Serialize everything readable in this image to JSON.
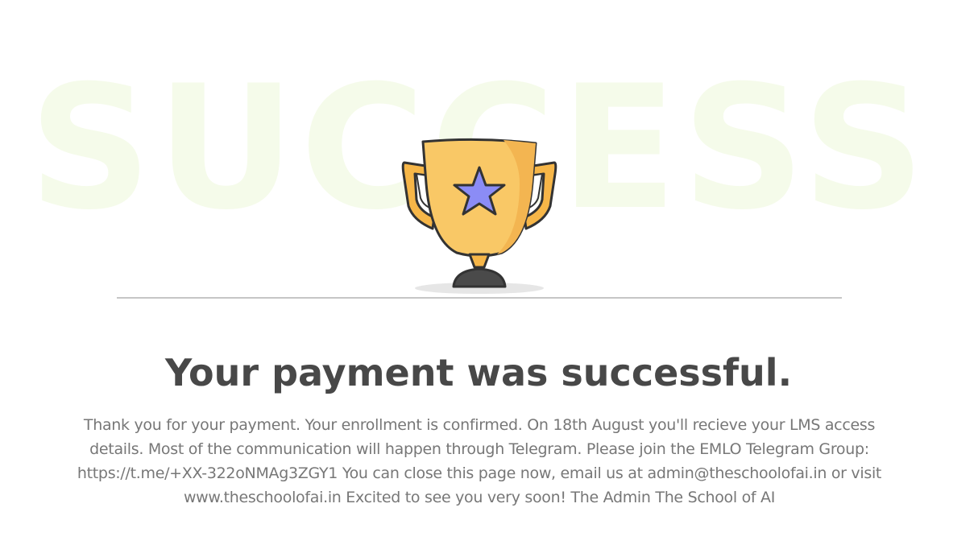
{
  "hero": {
    "background_word": "SUCCESS",
    "trophy_icon": "trophy-star-icon"
  },
  "content": {
    "title": "Your payment was successful.",
    "message": "Thank you for your payment. Your enrollment is confirmed. On 18th August you'll recieve your LMS access details. Most of the communication will happen through Telegram. Please join the EMLO Telegram Group: https://t.me/+XX-322oNMAg3ZGY1 You can close this page now, email us at admin@theschoolofai.in or visit www.theschoolofai.in Excited to see you very soon! The Admin The School of AI"
  },
  "colors": {
    "trophy_gold": "#f9c560",
    "star_purple": "#8b8cf6",
    "title_text": "#484848",
    "body_text": "#777777"
  }
}
